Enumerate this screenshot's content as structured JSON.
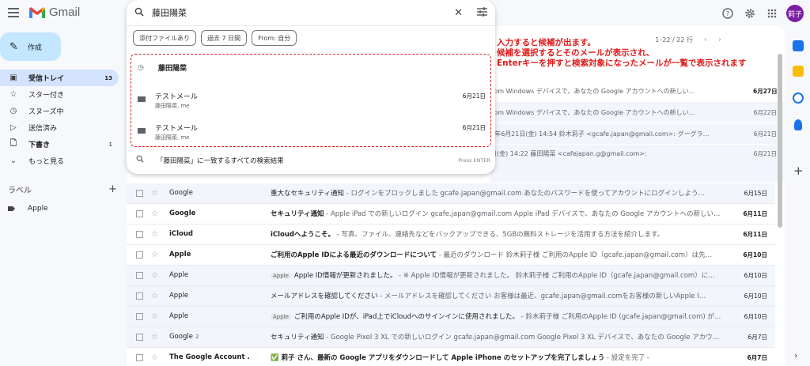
{
  "app": {
    "name": "Gmail"
  },
  "search": {
    "query": "藤田陽菜",
    "chips": [
      "添付ファイルあり",
      "過去 7 日間",
      "From: 自分"
    ],
    "recent": "藤田陽菜",
    "suggestions": [
      {
        "subject": "テストメール",
        "from": "藤田陽菜, me",
        "date": "6月21日"
      },
      {
        "subject": "テストメール",
        "from": "藤田陽菜, me",
        "date": "6月21日"
      }
    ],
    "all_results": "「藤田陽菜」に一致するすべての検索結果",
    "enter_hint": "Press ENTER"
  },
  "sidebar": {
    "compose": "作成",
    "items": [
      {
        "label": "受信トレイ",
        "count": "13",
        "icon": "inbox-icon"
      },
      {
        "label": "スター付き",
        "count": "",
        "icon": "star-icon"
      },
      {
        "label": "スヌーズ中",
        "count": "",
        "icon": "clock-icon"
      },
      {
        "label": "送信済み",
        "count": "",
        "icon": "send-icon"
      },
      {
        "label": "下書き",
        "count": "1",
        "icon": "draft-icon"
      },
      {
        "label": "もっと見る",
        "count": "",
        "icon": "chevron-down-icon"
      }
    ],
    "labels_heading": "ラベル",
    "labels": [
      "Apple"
    ]
  },
  "pager": {
    "range": "1–22 / 22 行"
  },
  "annotation": [
    "入力すると候補が出ます。",
    "候補を選択するとそのメールが表示され、",
    "Enterキーを押すと検索対象になったメールが一覧で表示されます"
  ],
  "partial_rows": [
    {
      "text": "com Windows デバイスで、あなたの Google アカウントへの新しい…",
      "date": "6月27日"
    },
    {
      "text": "com Windows デバイスで、あなたの Google アカウントへの新しい…",
      "date": "6月22日"
    },
    {
      "text": "4年6月21日(金) 14:54 鈴木莉子 <gcafe.japan@gmail.com>: グーグラ…",
      "date": "6月21日"
    },
    {
      "text": "日(金) 14:22 藤田陽菜 <cafejapan.g@gmail.com>:",
      "date": "6月21日"
    }
  ],
  "emails": [
    {
      "sender": "Google",
      "count": "",
      "badge": "",
      "subject": "重大なセキュリティ通知",
      "snippet": " - ログインをブロックしました gcafe.japan@gmail.com あなたのパスワードを使ってアカウントにログインしよう…",
      "date": "6月15日",
      "unread": false
    },
    {
      "sender": "Google",
      "count": "",
      "badge": "",
      "subject": "セキュリティ通知",
      "snippet": " - Apple iPad での新しいログイン gcafe.japan@gmail.com Apple iPad デバイスで、あなたの Google アカウントへの新しい…",
      "date": "6月11日",
      "unread": true
    },
    {
      "sender": "iCloud",
      "count": "",
      "badge": "",
      "subject": "iCloudへようこそ。",
      "snippet": " - 写真、ファイル、連絡先などをバックアップできる、5GBの無料ストレージを活用する方法を紹介します。",
      "date": "6月11日",
      "unread": true
    },
    {
      "sender": "Apple",
      "count": "",
      "badge": "",
      "subject": "ご利用のApple IDによる最近のダウンロードについて",
      "snippet": " - 最近のダウンロード 鈴木莉子様 ご利用のApple ID（gcafe.japan@gmail.com）は先…",
      "date": "6月10日",
      "unread": true
    },
    {
      "sender": "Apple",
      "count": "",
      "badge": "Apple",
      "subject": "Apple ID情報が更新されました。",
      "snippet": " - ※ Apple ID情報が更新されました。 鈴木莉子様 ご利用のApple ID（gcafe.japan@gmail.com）に…",
      "date": "6月10日",
      "unread": false
    },
    {
      "sender": "Apple",
      "count": "",
      "badge": "",
      "subject": "メールアドレスを確認してください",
      "snippet": " - メールアドレスを確認してください お客様は最近、gcafe.japan@gmail.comをお客様の新しいApple I…",
      "date": "6月10日",
      "unread": false
    },
    {
      "sender": "Apple",
      "count": "",
      "badge": "Apple",
      "subject": "ご利用のApple IDが、iPad上でiCloudへのサインインに使用されました。",
      "snippet": " - 鈴木莉子様 ご利用のApple ID (gcafe.japan@gmail.com) が…",
      "date": "6月10日",
      "unread": false
    },
    {
      "sender": "Google",
      "count": "2",
      "badge": "",
      "subject": "セキュリティ通知",
      "snippet": " - Google Pixel 3 XL での新しいログイン gcafe.japan@gmail.com Google Pixel 3 XL デバイスで、あなたの Google アカウ…",
      "date": "6月7日",
      "unread": false
    },
    {
      "sender": "The Google Account .",
      "count": "",
      "badge": "",
      "subject": "✅ 莉子 さん、最新の Google アプリをダウンロードして Apple iPhone のセットアップを完了しましょう",
      "snippet": " - 設定を完了 -",
      "date": "6月7日",
      "unread": true
    }
  ],
  "user_avatar": "莉子",
  "colors": {
    "annotation": "#e01a1a",
    "compose": "#c2e7ff",
    "active_nav": "#d3e3fd"
  }
}
